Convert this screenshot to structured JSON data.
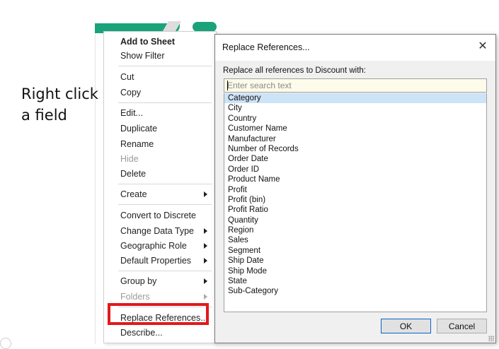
{
  "annotation": {
    "line1": "Right click",
    "line2": "a field"
  },
  "context_menu": {
    "items": [
      {
        "label": "Add to Sheet",
        "bold": true
      },
      {
        "label": "Show Filter"
      },
      {
        "label": "Cut"
      },
      {
        "label": "Copy"
      },
      {
        "label": "Edit..."
      },
      {
        "label": "Duplicate"
      },
      {
        "label": "Rename"
      },
      {
        "label": "Hide",
        "disabled": true
      },
      {
        "label": "Delete"
      },
      {
        "label": "Create",
        "submenu": true
      },
      {
        "label": "Convert to Discrete"
      },
      {
        "label": "Change Data Type",
        "submenu": true
      },
      {
        "label": "Geographic Role",
        "submenu": true
      },
      {
        "label": "Default Properties",
        "submenu": true
      },
      {
        "label": "Group by",
        "submenu": true
      },
      {
        "label": "Folders",
        "submenu": true,
        "disabled": true
      },
      {
        "label": "Replace References..."
      },
      {
        "label": "Describe..."
      }
    ],
    "highlight_color": "#e01a1a"
  },
  "dialog": {
    "title": "Replace References...",
    "prompt": "Replace all references to Discount with:",
    "search": {
      "value": "",
      "placeholder": "Enter search text"
    },
    "fields": [
      "Category",
      "City",
      "Country",
      "Customer Name",
      "Manufacturer",
      "Number of Records",
      "Order Date",
      "Order ID",
      "Product Name",
      "Profit",
      "Profit (bin)",
      "Profit Ratio",
      "Quantity",
      "Region",
      "Sales",
      "Segment",
      "Ship Date",
      "Ship Mode",
      "State",
      "Sub-Category"
    ],
    "selected_field": "Category",
    "ok_label": "OK",
    "cancel_label": "Cancel",
    "close_glyph": "✕"
  }
}
